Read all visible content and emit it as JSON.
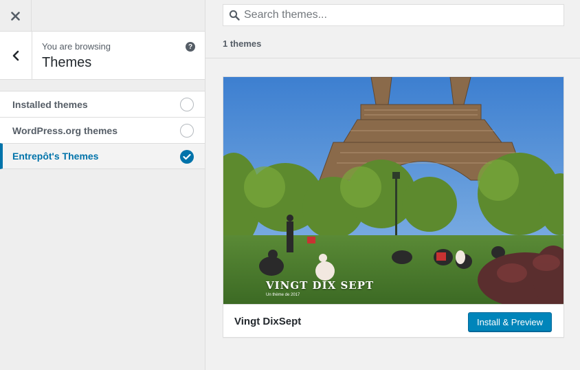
{
  "sidebar": {
    "browsing_label": "You are browsing",
    "browsing_title": "Themes",
    "help_label": "?",
    "sections": [
      {
        "label": "Installed themes",
        "selected": false
      },
      {
        "label": "WordPress.org themes",
        "selected": false
      },
      {
        "label": "Entrepôt's Themes",
        "selected": true
      }
    ]
  },
  "main": {
    "search_placeholder": "Search themes...",
    "count_label": "1 themes",
    "theme": {
      "name": "Vingt DixSept",
      "install_label": "Install & Preview",
      "screenshot_title": "VINGT DIX SEPT",
      "screenshot_tagline": "Un thème de 2017"
    }
  },
  "icons": {
    "close": "close-icon",
    "back": "chevron-left-icon",
    "help": "help-icon",
    "search": "search-icon",
    "check": "checkmark-icon"
  },
  "colors": {
    "accent": "#0073aa",
    "button": "#0085ba"
  }
}
